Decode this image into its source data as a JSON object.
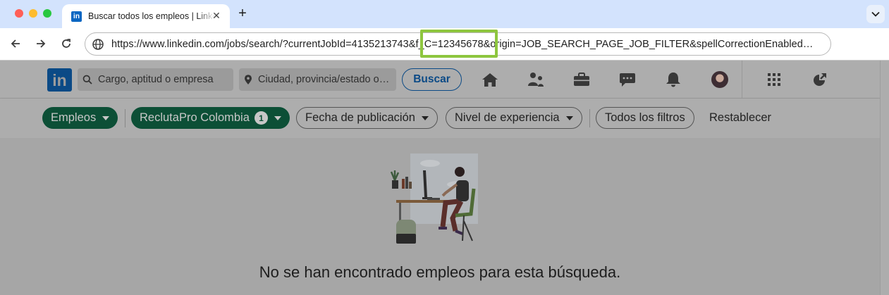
{
  "browser": {
    "tab": {
      "title": "Buscar todos los empleos | LinkedIn",
      "favicon": "in"
    },
    "url": "https://www.linkedin.com/jobs/search/?currentJobId=4135213743&f_C=12345678&origin=JOB_SEARCH_PAGE_JOB_FILTER&spellCorrectionEnabled…"
  },
  "header": {
    "logo": "in",
    "search_placeholder": "Cargo, aptitud o empresa",
    "location_placeholder": "Ciudad, provincia/estado o…",
    "search_button": "Buscar"
  },
  "filters": {
    "jobs": "Empleos",
    "company": "ReclutaPro Colombia",
    "company_count": "1",
    "date_posted": "Fecha de publicación",
    "experience": "Nivel de experiencia",
    "all_filters": "Todos los filtros",
    "reset": "Restablecer"
  },
  "main": {
    "empty_message": "No se han encontrado empleos para esta búsqueda."
  },
  "colors": {
    "highlight": "#8ec63f",
    "dimmed_page": "#a8a8a8",
    "pill_dark": "#0c4f36"
  }
}
